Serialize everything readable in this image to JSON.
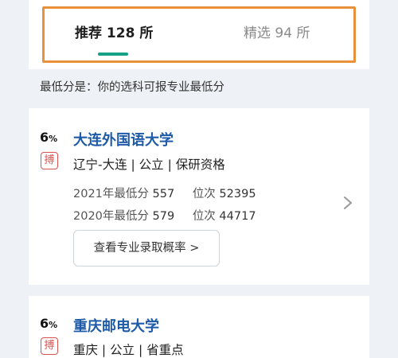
{
  "tabs": {
    "recommend_label": "推荐 128 所",
    "featured_label": "精选 94 所"
  },
  "hint": "最低分是：你的选科可报专业最低分",
  "colors": {
    "accent": "#16a085",
    "highlight_outline": "#e8913a",
    "link": "#1e5aa8",
    "badge": "#d9534f"
  },
  "universities": [
    {
      "probability": "6",
      "probability_unit": "%",
      "badge": "搏",
      "name": "大连外国语大学",
      "meta": "辽宁-大连 | 公立 | 保研资格",
      "stats": [
        {
          "year_label": "2021年最低分",
          "score": "557",
          "rank_label": "位次",
          "rank": "52395"
        },
        {
          "year_label": "2020年最低分",
          "score": "579",
          "rank_label": "位次",
          "rank": "44717"
        }
      ],
      "button_label": "查看专业录取概率 >",
      "chevron_icon": "chevron-right-icon"
    },
    {
      "probability": "6",
      "probability_unit": "%",
      "badge": "搏",
      "name": "重庆邮电大学",
      "meta": "重庆 | 公立 | 省重点"
    }
  ]
}
